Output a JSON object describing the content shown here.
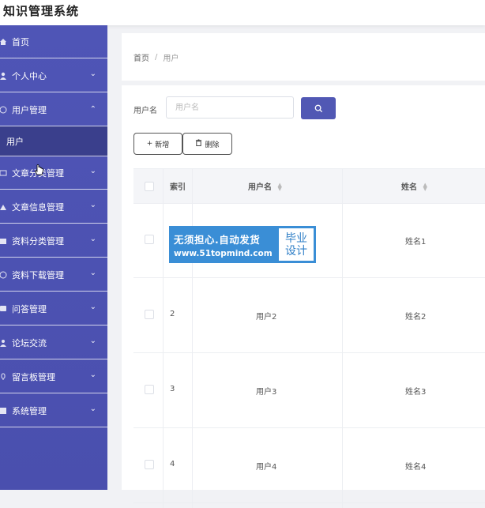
{
  "app": {
    "title": "知识管理系统"
  },
  "sidebar": {
    "items": [
      {
        "label": "首页",
        "icon": "home-icon",
        "expandable": false
      },
      {
        "label": "个人中心",
        "icon": "user-icon",
        "expandable": true
      },
      {
        "label": "用户管理",
        "icon": "user-manage-icon",
        "expandable": true,
        "expanded": true
      },
      {
        "label": "文章分类管理",
        "icon": "article-category-icon",
        "expandable": true
      },
      {
        "label": "文章信息管理",
        "icon": "article-info-icon",
        "expandable": true
      },
      {
        "label": "资料分类管理",
        "icon": "material-category-icon",
        "expandable": true
      },
      {
        "label": "资料下载管理",
        "icon": "download-icon",
        "expandable": true
      },
      {
        "label": "问答管理",
        "icon": "qa-icon",
        "expandable": true
      },
      {
        "label": "论坛交流",
        "icon": "forum-icon",
        "expandable": true
      },
      {
        "label": "留言板管理",
        "icon": "message-board-icon",
        "expandable": true
      },
      {
        "label": "系统管理",
        "icon": "system-icon",
        "expandable": true
      }
    ],
    "submenu_active": "用户"
  },
  "breadcrumb": {
    "home": "首页",
    "separator": "/",
    "current": "用户"
  },
  "search": {
    "label": "用户名",
    "placeholder": "用户名",
    "value": ""
  },
  "toolbar": {
    "add_label": "新增",
    "delete_label": "删除"
  },
  "table": {
    "headers": {
      "index": "索引",
      "username": "用户名",
      "name": "姓名"
    },
    "rows": [
      {
        "index": "",
        "username": "",
        "name": "姓名1"
      },
      {
        "index": "2",
        "username": "用户2",
        "name": "姓名2"
      },
      {
        "index": "3",
        "username": "用户3",
        "name": "姓名3"
      },
      {
        "index": "4",
        "username": "用户4",
        "name": "姓名4"
      }
    ]
  },
  "watermark": {
    "line1": "无须担心.自动发货",
    "line2": "www.51topmind.com",
    "badge_top": "毕业",
    "badge_bottom": "设计"
  },
  "colors": {
    "sidebar": "#4f55b6",
    "submenu_active": "#3a3f8c",
    "primary": "#5158b4",
    "watermark": "#3a8ed6"
  }
}
